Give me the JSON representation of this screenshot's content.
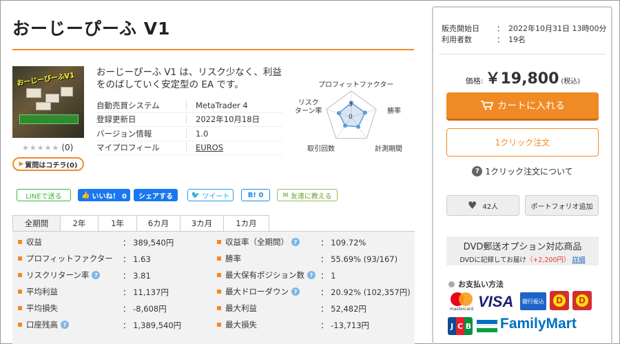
{
  "product": {
    "title": "おーじーぴーふ V1",
    "description": "おーじーぴーふ V1 は、リスク少なく、利益をのばしていく安定型の EA です。",
    "thumb_text": "おーじーびーふV1",
    "stars": "★★★★★",
    "rating_count": "(0)",
    "question_button": "質問はコチラ(0)"
  },
  "info": [
    {
      "key": "自動売買システム",
      "value": "MetaTrader 4"
    },
    {
      "key": "登録更新日",
      "value": "2022年10月18日"
    },
    {
      "key": "バージョン情報",
      "value": "1.0"
    },
    {
      "key": "マイプロフィール",
      "value": "EUROS"
    }
  ],
  "radar": {
    "labels": {
      "pf": "プロフィットファクター",
      "win": "勝率",
      "period": "計測期間",
      "trades": "取引回数",
      "risk": "リスク\nターン率"
    },
    "tick_top": "3",
    "tick_zero": "0",
    "values": [
      0.55,
      0.55,
      0.45,
      0.4,
      0.5
    ]
  },
  "sns": {
    "line": "LINEで送る",
    "like": "いいね！ 0",
    "share": "シェアする",
    "tweet": "ツイート",
    "hatena": "B! 0",
    "friend": "友達に教える"
  },
  "tabs": [
    "全期間",
    "2年",
    "1年",
    "6カ月",
    "3カ月",
    "1カ月"
  ],
  "stats_left": [
    {
      "label": "収益",
      "value": "389,540円",
      "help": false
    },
    {
      "label": "プロフィットファクター",
      "value": "1.63",
      "help": false
    },
    {
      "label": "リスクリターン率",
      "value": "3.81",
      "help": true
    },
    {
      "label": "平均利益",
      "value": "11,137円",
      "help": false
    },
    {
      "label": "平均損失",
      "value": "-8,608円",
      "help": false
    },
    {
      "label": "口座残高",
      "value": "1,389,540円",
      "help": true
    }
  ],
  "stats_right": [
    {
      "label": "収益率（全期間）",
      "value": "109.72%",
      "help": true
    },
    {
      "label": "勝率",
      "value": "55.69% (93/167)",
      "help": false
    },
    {
      "label": "最大保有ポジション数",
      "value": "1",
      "help": true
    },
    {
      "label": "最大ドローダウン",
      "value": "20.92% (102,357円)",
      "help": true
    },
    {
      "label": "最大利益",
      "value": "52,482円",
      "help": false
    },
    {
      "label": "最大損失",
      "value": "-13,713円",
      "help": false
    }
  ],
  "stat_sep": "：",
  "sidebar": {
    "sale_start_label": "販売開始日",
    "sale_start_value": "2022年10月31日 13時00分",
    "users_label": "利用者数",
    "users_value": "19名",
    "price_label": "価格:",
    "price": "￥19,800",
    "tax": "(税込)",
    "cart_button": "カートに入れる",
    "oneclick_button": "1クリック注文",
    "oneclick_about": "1クリック注文について",
    "favorites": "42人",
    "portfolio": "ポートフォリオ追加",
    "dvd_title": "DVD郵送オプション対応商品",
    "dvd_text": "DVDに記録してお届け",
    "dvd_price": "（+2,200円）",
    "dvd_link": "詳細",
    "payment_title": "お支払い方法",
    "mastercard": "mastercard",
    "visa": "VISA",
    "bank": "銀行振込",
    "daily_y": "D",
    "jcb": [
      "J",
      "C",
      "B"
    ],
    "familymart": "FamilyMart"
  },
  "colors": {
    "accent": "#f08a24",
    "link_blue": "#1565c0",
    "radar_blue": "#5b9bd5"
  }
}
